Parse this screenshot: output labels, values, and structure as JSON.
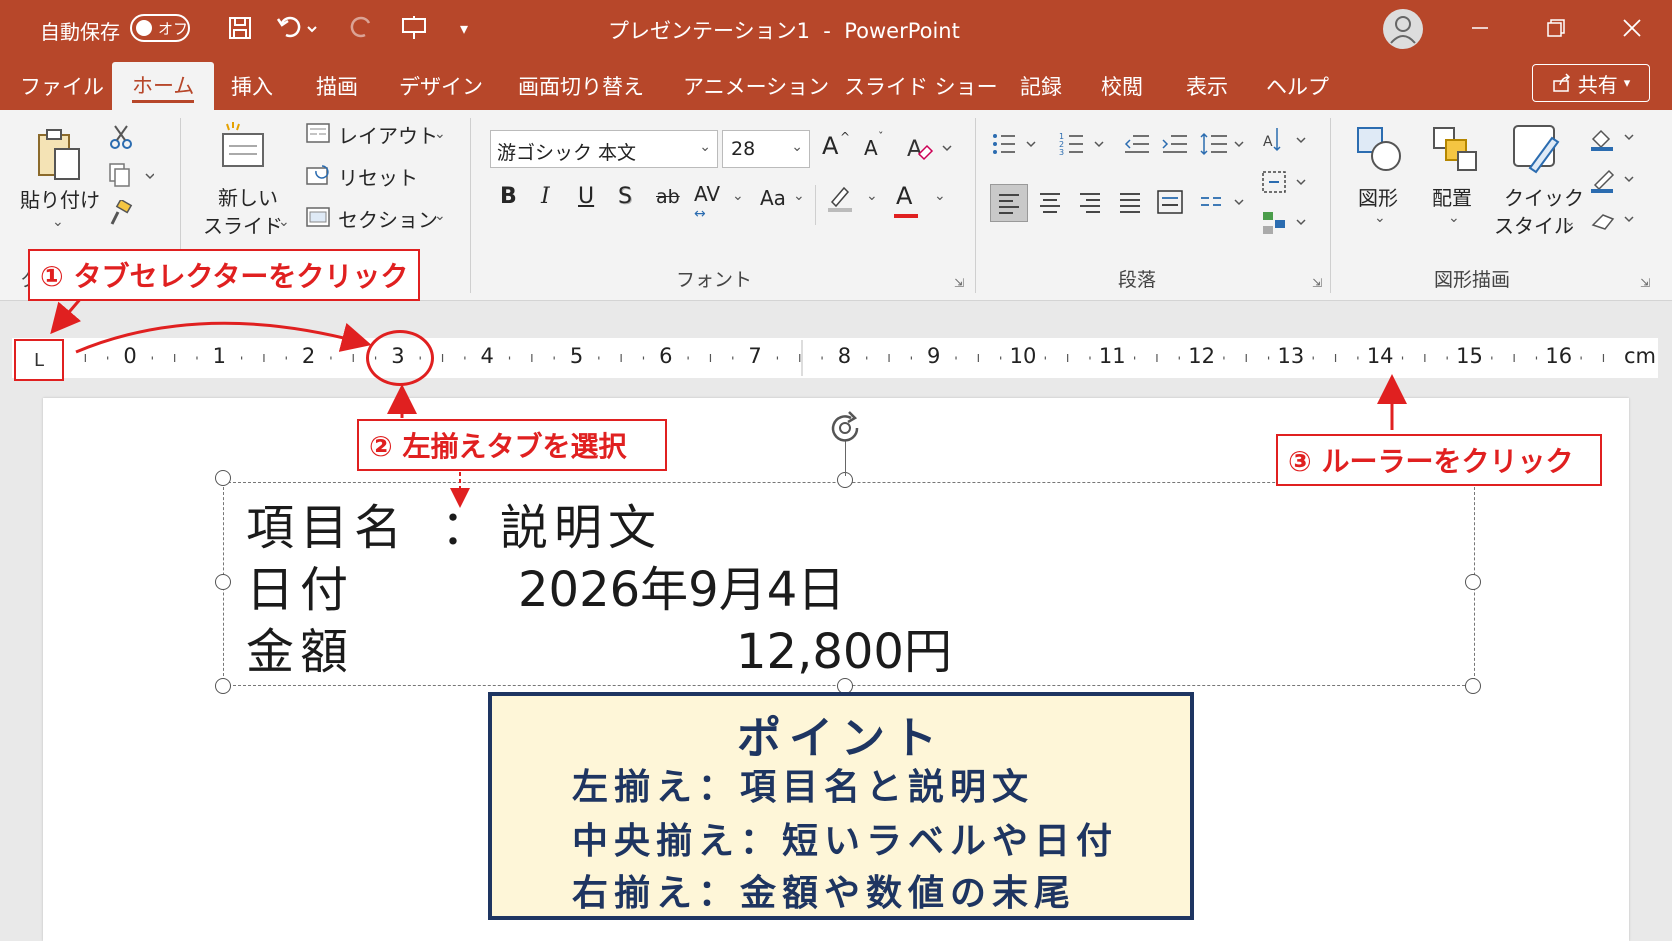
{
  "titlebar": {
    "autosave_label": "自動保存",
    "autosave_toggle": "オフ",
    "document_title": "プレゼンテーション1  -  PowerPoint"
  },
  "tabs": [
    "ファイル",
    "ホーム",
    "挿入",
    "描画",
    "デザイン",
    "画面切り替え",
    "アニメーション",
    "スライド ショー",
    "記録",
    "校閲",
    "表示",
    "ヘルプ"
  ],
  "active_tab": "ホーム",
  "share_button": "共有",
  "clipboard": {
    "paste": "貼り付け"
  },
  "slides": {
    "new_slide_line1": "新しい",
    "new_slide_line2": "スライド",
    "layout": "レイアウト",
    "reset": "リセット",
    "section": "セクション"
  },
  "font": {
    "name": "游ゴシック 本文",
    "size": "28",
    "group_label": "フォント",
    "bold": "B",
    "italic": "I",
    "underline": "U",
    "shadow": "S",
    "strike": "ab",
    "spacing": "AV",
    "case": "Aa",
    "grow": "A",
    "shrink": "A",
    "font_color": "A"
  },
  "paragraph": {
    "group_label": "段落"
  },
  "drawing": {
    "shapes": "図形",
    "arrange": "配置",
    "quick_styles_line1": "クイック",
    "quick_styles_line2": "スタイル",
    "group_label": "図形描画"
  },
  "clipboard_group_partial": "ク",
  "ruler": {
    "numbers": [
      "0",
      "1",
      "2",
      "3",
      "4",
      "5",
      "6",
      "7",
      "8",
      "9",
      "10",
      "11",
      "12",
      "13",
      "14",
      "15",
      "16"
    ],
    "unit": "cm",
    "tab_selector": "L"
  },
  "slide_text": {
    "row1_label": "項目名",
    "row1_sep": "：",
    "row1_value": "説明文",
    "row2_label": "日付",
    "row2_value": "2026年9月4日",
    "row3_label": "金額",
    "row3_value": "12,800円"
  },
  "callouts": {
    "step1": "① タブセレクターをクリック",
    "step2": "② 左揃えタブを選択",
    "step3": "③ ルーラーをクリック"
  },
  "point_box": {
    "title": "ポイント",
    "line1": "左揃え：項目名と説明文",
    "line2": "中央揃え：短いラベルや日付",
    "line3": "右揃え：金額や数値の末尾"
  },
  "colors": {
    "accent": "#b7472a",
    "callout_red": "#e02020",
    "point_border": "#1e3561",
    "point_bg": "#fef6d8"
  }
}
